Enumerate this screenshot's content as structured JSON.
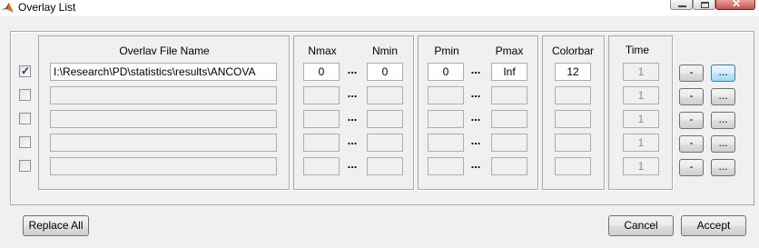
{
  "window": {
    "title": "Overlay List"
  },
  "headers": {
    "file_name": "Overlav File Name",
    "nmax": "Nmax",
    "nmin": "Nmin",
    "pmin": "Pmin",
    "pmax": "Pmax",
    "colorbar": "Colorbar",
    "time": "Time"
  },
  "ellipsis": "...",
  "rows": [
    {
      "checked": true,
      "file": "I:\\Research\\PD\\statistics\\results\\ANCOVA",
      "nmax": "0",
      "nmin": "0",
      "pmin": "0",
      "pmax": "Inf",
      "colorbar": "12",
      "time": "1",
      "minus": "-",
      "browse": "..."
    },
    {
      "checked": false,
      "file": "",
      "nmax": "",
      "nmin": "",
      "pmin": "",
      "pmax": "",
      "colorbar": "",
      "time": "1",
      "minus": "-",
      "browse": "..."
    },
    {
      "checked": false,
      "file": "",
      "nmax": "",
      "nmin": "",
      "pmin": "",
      "pmax": "",
      "colorbar": "",
      "time": "1",
      "minus": "-",
      "browse": "..."
    },
    {
      "checked": false,
      "file": "",
      "nmax": "",
      "nmin": "",
      "pmin": "",
      "pmax": "",
      "colorbar": "",
      "time": "1",
      "minus": "-",
      "browse": "..."
    },
    {
      "checked": false,
      "file": "",
      "nmax": "",
      "nmin": "",
      "pmin": "",
      "pmax": "",
      "colorbar": "",
      "time": "1",
      "minus": "-",
      "browse": "..."
    }
  ],
  "footer": {
    "replace_all": "Replace All",
    "cancel": "Cancel",
    "accept": "Accept"
  },
  "colors": {
    "focus_border": "#3c7fb1",
    "check_mark": "#21406d"
  }
}
